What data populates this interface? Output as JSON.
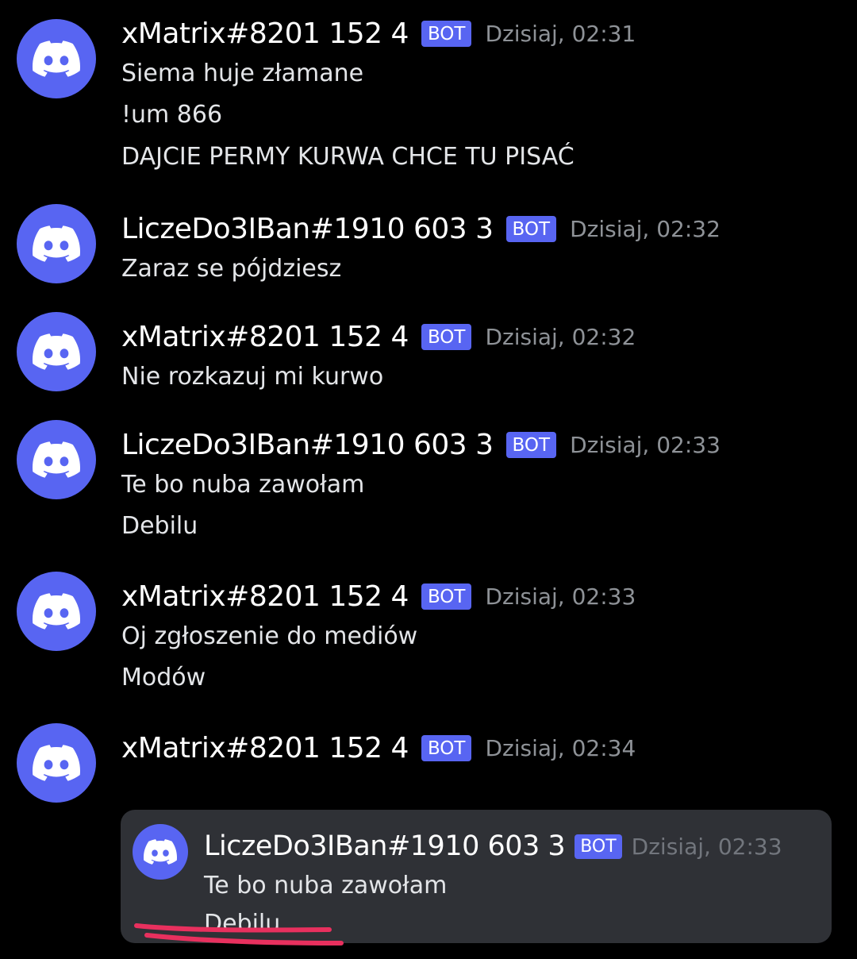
{
  "colors": {
    "background": "#000000",
    "blurple": "#5865f2",
    "username": "#ffffff",
    "timestamp": "#8e9297",
    "text": "#e3e5e8",
    "quote_card": "#2f3136",
    "scribble": "#e8305e"
  },
  "icons": {
    "avatar": "discord-logo-icon"
  },
  "messages": [
    {
      "author": "xMatrix#8201 152 4",
      "badge": "BOT",
      "timestamp": "Dzisiaj, 02:31",
      "lines": [
        "Siema huje złamane",
        "!um 866",
        "DAJCIE PERMY KURWA CHCE TU PISAĆ"
      ]
    },
    {
      "author": "LiczeDo3IBan#1910 603 3",
      "badge": "BOT",
      "timestamp": "Dzisiaj, 02:32",
      "lines": [
        "Zaraz se pójdziesz"
      ]
    },
    {
      "author": "xMatrix#8201 152 4",
      "badge": "BOT",
      "timestamp": "Dzisiaj, 02:32",
      "lines": [
        "Nie rozkazuj mi kurwo"
      ]
    },
    {
      "author": "LiczeDo3IBan#1910 603 3",
      "badge": "BOT",
      "timestamp": "Dzisiaj, 02:33",
      "lines": [
        "Te bo nuba zawołam",
        "Debilu"
      ]
    },
    {
      "author": "xMatrix#8201 152 4",
      "badge": "BOT",
      "timestamp": "Dzisiaj, 02:33",
      "lines": [
        "Oj zgłoszenie do mediów",
        "Modów"
      ]
    },
    {
      "author": "xMatrix#8201 152 4",
      "badge": "BOT",
      "timestamp": "Dzisiaj, 02:34",
      "lines": []
    }
  ],
  "quoted": {
    "author": "LiczeDo3IBan#1910 603 3",
    "badge": "BOT",
    "timestamp": "Dzisiaj, 02:33",
    "lines": [
      "Te bo nuba zawołam",
      "Debilu"
    ]
  }
}
